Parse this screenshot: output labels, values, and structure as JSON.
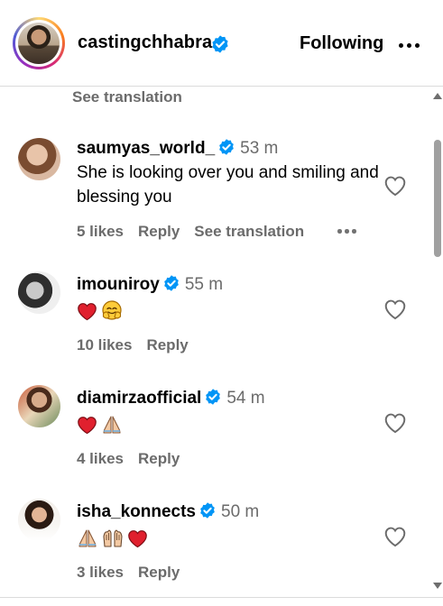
{
  "header": {
    "username": "castingchhabra",
    "verified_icon": "verified-badge-icon",
    "follow_label": "Following",
    "more_icon": "more-horizontal-icon"
  },
  "top_fragment": {
    "see_translation": "See translation"
  },
  "colors": {
    "verified": "#0095f6",
    "muted_text": "#6b6b6b",
    "divider": "#dbdbdb"
  },
  "comments": [
    {
      "username": "saumyas_world_",
      "time": "53 m",
      "text": "She is looking over you and smiling and blessing you",
      "likes": "5 likes",
      "reply": "Reply",
      "see_translation": "See translation",
      "emojis": []
    },
    {
      "username": "imouniroy",
      "time": "55 m",
      "text": "",
      "likes": "10 likes",
      "reply": "Reply",
      "emojis": [
        "red-heart",
        "smiling-face-with-open-hands"
      ]
    },
    {
      "username": "diamirzaofficial",
      "time": "54 m",
      "text": "",
      "likes": "4 likes",
      "reply": "Reply",
      "emojis": [
        "red-heart",
        "folded-hands"
      ]
    },
    {
      "username": "isha_konnects",
      "time": "50 m",
      "text": "",
      "likes": "3 likes",
      "reply": "Reply",
      "emojis": [
        "folded-hands",
        "raising-hands",
        "red-heart"
      ]
    }
  ]
}
